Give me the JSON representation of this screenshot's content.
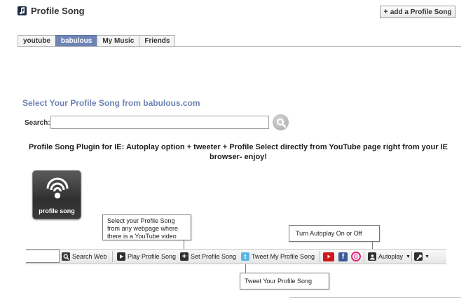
{
  "header": {
    "title": "Profile Song",
    "add_button_label": "add a Profile Song"
  },
  "tabs": [
    {
      "label": "youtube",
      "active": false
    },
    {
      "label": "babulous",
      "active": true
    },
    {
      "label": "My Music",
      "active": false
    },
    {
      "label": "Friends",
      "active": false
    }
  ],
  "section": {
    "title": "Select Your Profile Song from babulous.com",
    "search_label": "Search:",
    "search_value": "",
    "plugin_text": "Profile Song Plugin for IE: Autoplay option + tweeter + Profile Select directly from YouTube page right from your IE browser- enjoy!"
  },
  "logo": {
    "label": "profile song"
  },
  "callouts": {
    "select": "Select your Profile Song from any webpage where there is a YouTube video",
    "autoplay": "Turn Autoplay On or Off",
    "tweet": "Tweet Your Profile Song"
  },
  "toolbar": {
    "search_value": "",
    "search_web": "Search Web",
    "play": "Play Profile Song",
    "set": "Set Profile Song",
    "tweet": "Tweet My Profile Song",
    "autoplay": "Autoplay"
  },
  "colors": {
    "accent": "#6d84b4",
    "facebook": "#3b5998",
    "youtube": "#cc181e",
    "twitter": "#5ab4e6",
    "g_pink": "#e0237a"
  }
}
